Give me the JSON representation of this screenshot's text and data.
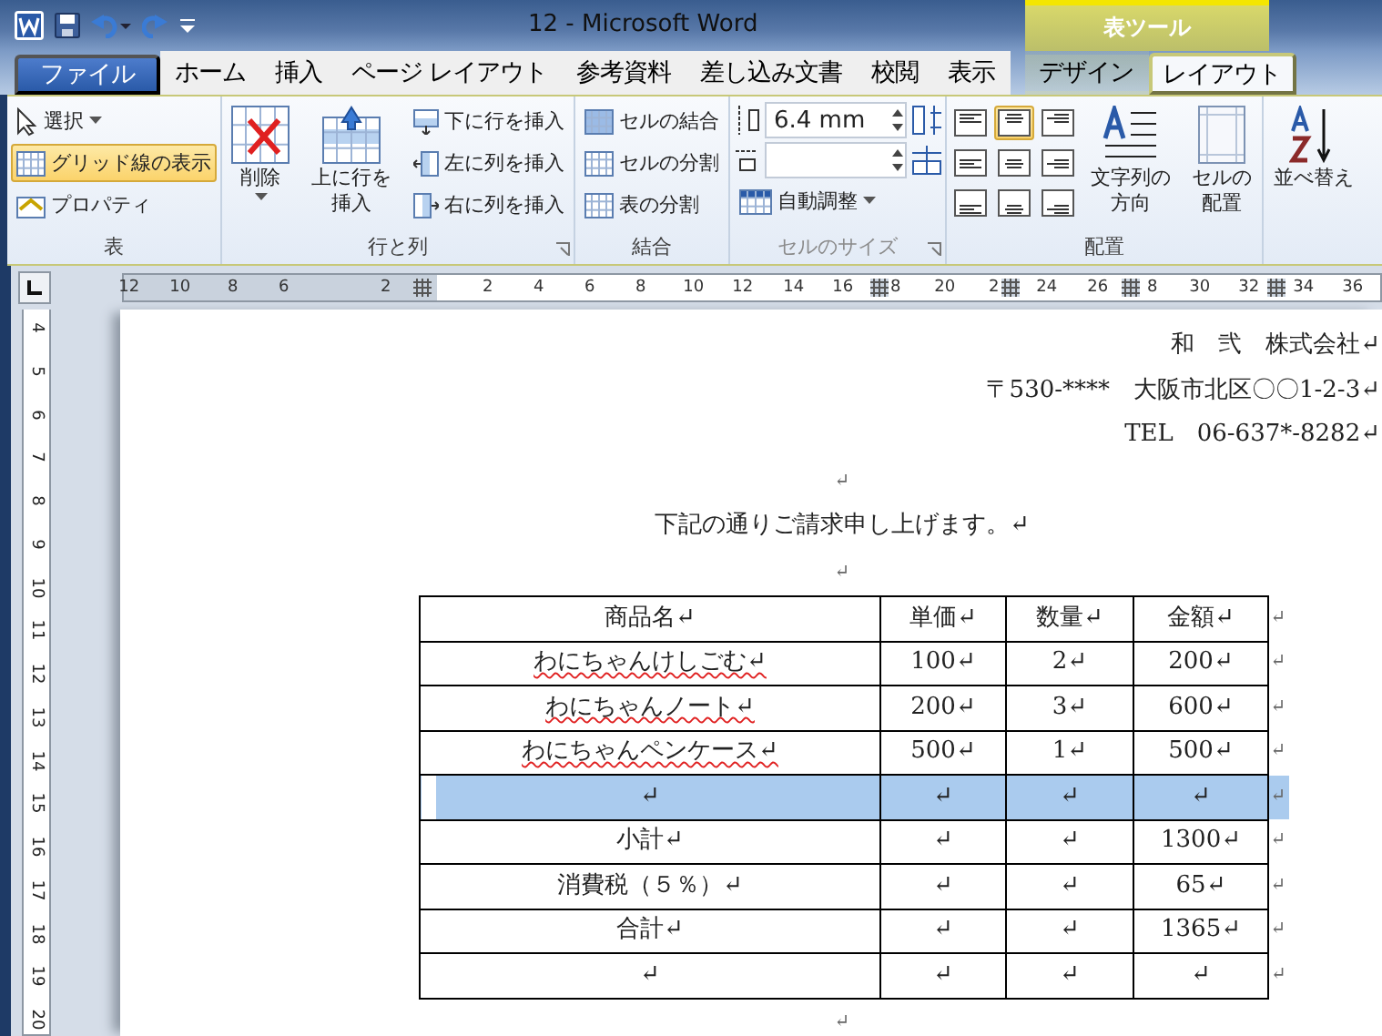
{
  "title_bar": {
    "title": "12 - Microsoft Word",
    "contextual_group": "表ツール"
  },
  "tabs": [
    {
      "label": "ファイル",
      "kind": "file",
      "selected": false
    },
    {
      "label": "ホーム",
      "kind": "normal",
      "selected": false
    },
    {
      "label": "挿入",
      "kind": "normal",
      "selected": false
    },
    {
      "label": "ページ レイアウト",
      "kind": "normal",
      "selected": false
    },
    {
      "label": "参考資料",
      "kind": "normal",
      "selected": false
    },
    {
      "label": "差し込み文書",
      "kind": "normal",
      "selected": false
    },
    {
      "label": "校閲",
      "kind": "normal",
      "selected": false
    },
    {
      "label": "表示",
      "kind": "normal",
      "selected": false
    },
    {
      "label": "デザイン",
      "kind": "contextual",
      "selected": false
    },
    {
      "label": "レイアウト",
      "kind": "contextual",
      "selected": true
    }
  ],
  "ribbon": {
    "table": {
      "label": "表",
      "select": "選択",
      "gridlines": {
        "label": "グリッド線の表示",
        "on": true
      },
      "properties": "プロパティ"
    },
    "rows_columns": {
      "label": "行と列",
      "delete": "削除",
      "insert_above": "上に行を挿入",
      "insert_below": "下に行を挿入",
      "insert_left": "左に列を挿入",
      "insert_right": "右に列を挿入"
    },
    "merge": {
      "label": "結合",
      "items": [
        "セルの結合",
        "セルの分割",
        "表の分割"
      ]
    },
    "cell_size": {
      "label": "セルのサイズ",
      "height": "6.4 mm",
      "autofit": "自動調整"
    },
    "alignment": {
      "label": "配置",
      "buttons": [
        {
          "selected": false
        },
        {
          "selected": true
        },
        {
          "selected": false
        },
        {
          "selected": false
        },
        {
          "selected": false
        },
        {
          "selected": false
        },
        {
          "selected": false
        },
        {
          "selected": false
        },
        {
          "selected": false
        }
      ],
      "text_direction": "文字列の方向",
      "cell_margins": "セルの配置"
    },
    "sort": "並べ替え"
  },
  "ruler": {
    "horizontal": [
      {
        "kind": "number",
        "label": "12"
      },
      {
        "kind": "number",
        "label": "10"
      },
      {
        "kind": "number",
        "label": "8"
      },
      {
        "kind": "number",
        "label": "6"
      },
      {
        "kind": "number",
        "label": "2"
      },
      {
        "kind": "marker"
      },
      {
        "kind": "number",
        "label": "2"
      },
      {
        "kind": "number",
        "label": "4"
      },
      {
        "kind": "number",
        "label": "6"
      },
      {
        "kind": "number",
        "label": "8"
      },
      {
        "kind": "number",
        "label": "10"
      },
      {
        "kind": "number",
        "label": "12"
      },
      {
        "kind": "number",
        "label": "14"
      },
      {
        "kind": "number",
        "label": "16"
      },
      {
        "kind": "marker"
      },
      {
        "kind": "number",
        "label": "8"
      },
      {
        "kind": "number",
        "label": "20"
      },
      {
        "kind": "number",
        "label": "2"
      },
      {
        "kind": "marker"
      },
      {
        "kind": "number",
        "label": "24"
      },
      {
        "kind": "number",
        "label": "26"
      },
      {
        "kind": "marker"
      },
      {
        "kind": "number",
        "label": "8"
      },
      {
        "kind": "number",
        "label": "30"
      },
      {
        "kind": "number",
        "label": "32"
      },
      {
        "kind": "marker"
      },
      {
        "kind": "number",
        "label": "34"
      },
      {
        "kind": "number",
        "label": "36"
      }
    ],
    "vertical": [
      "4",
      "5",
      "6",
      "7",
      "8",
      "9",
      "10",
      "11",
      "12",
      "13",
      "14",
      "15",
      "16",
      "17",
      "18",
      "19",
      "20"
    ]
  },
  "document": {
    "header_lines": [
      "和　弐　株式会社↵",
      "〒530-****　大阪市北区〇〇1-2-3↵",
      "TEL　06-637*-8282↵"
    ],
    "blank_line_1": "↵",
    "message": "下記の通りご請求申し上げます。↵",
    "blank_line_2": "↵",
    "table": {
      "rows": [
        {
          "selected": false,
          "spell_error": false,
          "cells": [
            "商品名↵",
            "単価↵",
            "数量↵",
            "金額↵"
          ],
          "end_mark": "↵"
        },
        {
          "selected": false,
          "spell_error": true,
          "cells": [
            "わにちゃんけしごむ↵",
            "100↵",
            "2↵",
            "200↵"
          ],
          "end_mark": "↵"
        },
        {
          "selected": false,
          "spell_error": true,
          "cells": [
            "わにちゃんノート↵",
            "200↵",
            "3↵",
            "600↵"
          ],
          "end_mark": "↵"
        },
        {
          "selected": false,
          "spell_error": true,
          "cells": [
            "わにちゃんペンケース↵",
            "500↵",
            "1↵",
            "500↵"
          ],
          "end_mark": "↵"
        },
        {
          "selected": true,
          "spell_error": false,
          "cells": [
            "↵",
            "↵",
            "↵",
            "↵"
          ],
          "end_mark": "↵"
        },
        {
          "selected": false,
          "spell_error": false,
          "cells": [
            "小計↵",
            "↵",
            "↵",
            "1300↵"
          ],
          "end_mark": "↵"
        },
        {
          "selected": false,
          "spell_error": false,
          "cells": [
            "消費税（５％）↵",
            "↵",
            "↵",
            "65↵"
          ],
          "end_mark": "↵"
        },
        {
          "selected": false,
          "spell_error": false,
          "cells": [
            "合計↵",
            "↵",
            "↵",
            "1365↵"
          ],
          "end_mark": "↵"
        },
        {
          "selected": false,
          "spell_error": false,
          "cells": [
            "↵",
            "↵",
            "↵",
            "↵"
          ],
          "end_mark": "↵"
        }
      ]
    },
    "end_mark": "↵"
  }
}
